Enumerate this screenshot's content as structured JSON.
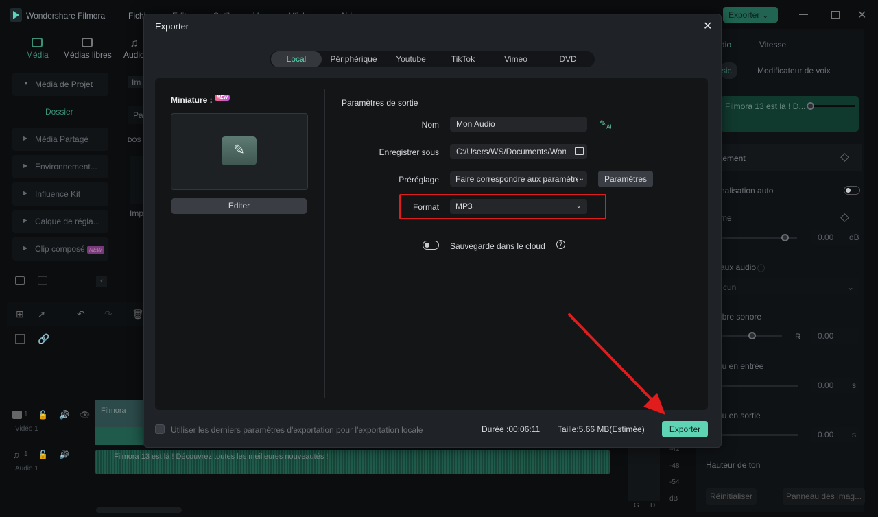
{
  "app": {
    "title": "Wondershare Filmora",
    "menu": [
      "Fichier",
      "Editer",
      "Outils",
      "Vue",
      "Affichage",
      "Aide"
    ],
    "export_button": "Exporter"
  },
  "left_tabs": [
    "Média",
    "Médias libres",
    "Audio"
  ],
  "sidebar": {
    "items": [
      {
        "label": "Média de Projet"
      },
      {
        "label": "Dossier"
      },
      {
        "label": "Média Partagé"
      },
      {
        "label": "Environnement..."
      },
      {
        "label": "Influence Kit"
      },
      {
        "label": "Calque de régla..."
      },
      {
        "label": "Clip composé",
        "badge": "NEW"
      }
    ]
  },
  "media_panel": {
    "import": "Im",
    "search": "Pa",
    "folder": "DOS",
    "import2": "Imp"
  },
  "timeline": {
    "tracks": [
      {
        "label": "Vidéo 1",
        "num": "1"
      },
      {
        "label": "Audio 1",
        "num": "1"
      }
    ],
    "video_clip": "Filmora",
    "audio_clip": "Filmora 13 est là ! Découvrez toutes les meilleures nouveautés !",
    "meter": [
      "-42",
      "-48",
      "-54",
      "dB"
    ],
    "channels": [
      "G",
      "D"
    ]
  },
  "right_panel": {
    "tabs": [
      "Audio",
      "Vitesse"
    ],
    "subtabs": [
      "Basic",
      "Modificateur de voix"
    ],
    "clip": "Filmora 13 est là ! D...",
    "sections": [
      "Ajustement",
      "Normalisation auto",
      "Volume",
      "Canaux audio",
      "Aucun",
      "Équilibre sonore",
      "Fondu en entrée",
      "Fondu en sortie",
      "Hauteur de ton"
    ],
    "visible_sections": [
      "tement",
      "nalisation auto",
      "me",
      "aux audio",
      "cun",
      "ibre sonore",
      "lu en entrée",
      "lu en sortie",
      "Hauteur de ton"
    ],
    "volume": "0.00",
    "volume_unit": "dB",
    "balance_r": "R",
    "balance": "0.00",
    "fade_in": "0.00",
    "fade_out": "0.00",
    "sec_unit": "s",
    "reset": "Réinitialiser",
    "keyframe": "Panneau des imag..."
  },
  "dialog": {
    "title": "Exporter",
    "tabs": [
      "Local",
      "Périphérique",
      "Youtube",
      "TikTok",
      "Vimeo",
      "DVD"
    ],
    "active_tab": "Local",
    "thumbnail": {
      "label": "Miniature :",
      "badge": "NEW",
      "edit": "Editer"
    },
    "settings": {
      "heading": "Paramètres de sortie",
      "name_label": "Nom",
      "name": "Mon Audio",
      "save_label": "Enregistrer sous",
      "save_path": "C:/Users/WS/Documents/Wondershare",
      "preset_label": "Préréglage",
      "preset": "Faire correspondre aux paramètres",
      "preset_button": "Paramètres",
      "format_label": "Format",
      "format": "MP3",
      "cloud_label": "Sauvegarde dans le cloud",
      "cloud_enabled": false
    },
    "footer": {
      "checkbox": "Utiliser les derniers paramètres d'exportation pour l'exportation locale",
      "duration": "Durée :00:06:11",
      "size": "Taille:5.66 MB(Estimée)",
      "export": "Exporter"
    }
  },
  "colors": {
    "accent": "#5fd4b5",
    "highlight": "#e01c1c"
  }
}
